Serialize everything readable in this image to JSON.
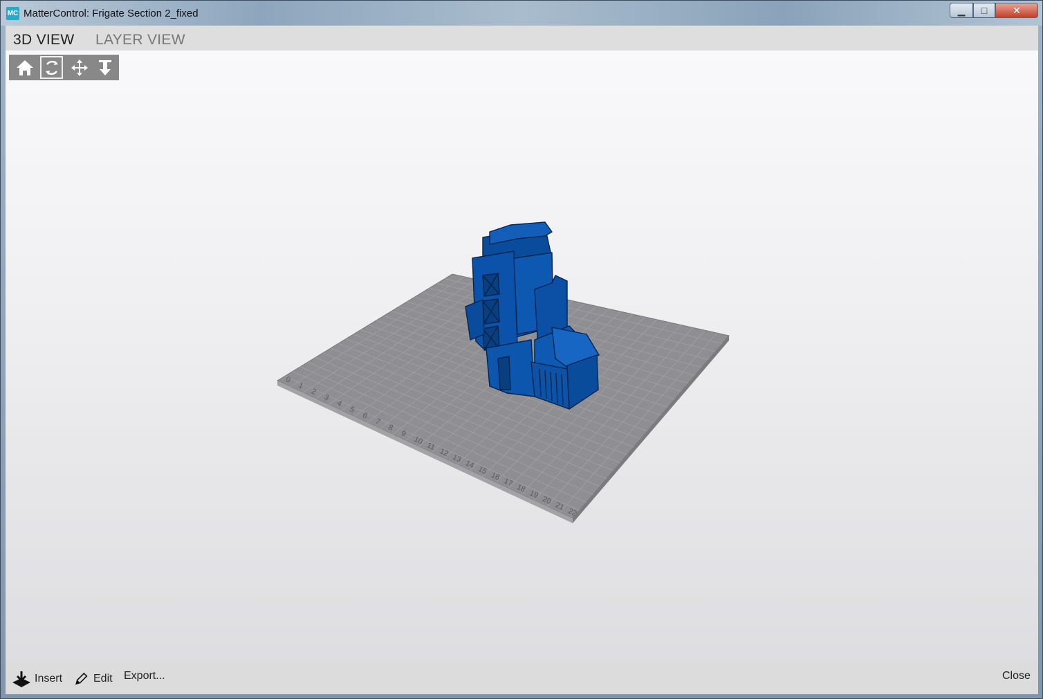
{
  "window": {
    "app_icon_text": "MC",
    "title": "MatterControl: Frigate Section 2_fixed",
    "min_symbol": "▁",
    "max_symbol": "□",
    "close_symbol": "✕"
  },
  "tabs": [
    {
      "label": "3D VIEW",
      "active": true
    },
    {
      "label": "LAYER VIEW",
      "active": false
    }
  ],
  "view_tools": [
    {
      "icon": "home-icon",
      "selected": false
    },
    {
      "icon": "rotate-icon",
      "selected": true
    },
    {
      "icon": "move-icon",
      "selected": false
    },
    {
      "icon": "zoom-icon",
      "selected": false
    }
  ],
  "bed": {
    "ruler_labels": [
      "0",
      "1",
      "2",
      "3",
      "4",
      "5",
      "6",
      "7",
      "8",
      "9",
      "10",
      "11",
      "12",
      "13",
      "14",
      "15",
      "16",
      "17",
      "18",
      "19",
      "20",
      "21",
      "22"
    ],
    "bed_color": "#8f8f93",
    "model_color": "#0b52a8"
  },
  "bottom": {
    "insert": "Insert",
    "edit": "Edit",
    "export": "Export...",
    "close": "Close"
  }
}
